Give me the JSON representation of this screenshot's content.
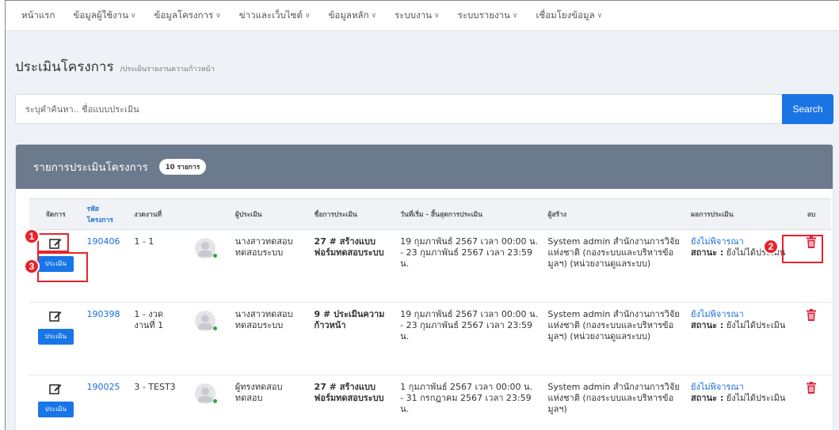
{
  "nav": {
    "items": [
      {
        "label": "หน้าแรก",
        "dropdown": false
      },
      {
        "label": "ข้อมูลผู้ใช้งาน",
        "dropdown": true
      },
      {
        "label": "ข้อมูลโครงการ",
        "dropdown": true
      },
      {
        "label": "ข่าวและเว็บไซต์",
        "dropdown": true
      },
      {
        "label": "ข้อมูลหลัก",
        "dropdown": true
      },
      {
        "label": "ระบบงาน",
        "dropdown": true
      },
      {
        "label": "ระบบรายงาน",
        "dropdown": true
      },
      {
        "label": "เชื่อมโยงข้อมูล",
        "dropdown": true
      }
    ]
  },
  "page": {
    "title": "ประเมินโครงการ",
    "breadcrumb": "/ประเมินรายงานความก้าวหน้า"
  },
  "search": {
    "placeholder": "ระบุคำค้นหา.. ชื่อแบบประเมิน",
    "button_label": "Search"
  },
  "panel": {
    "title": "รายการประเมินโครงการ",
    "count_badge": "10 รายการ"
  },
  "table": {
    "headers": {
      "manage": "จัดการ",
      "code": "รหัสโครงการ",
      "period": "งวดงานที่",
      "avatar": "",
      "assessor": "ผู้ประเมิน",
      "name": "ชื่อการประเมิน",
      "date": "วันที่เริ่ม - สิ้นสุดการประเมิน",
      "creator": "ผู้สร้าง",
      "result": "ผลการประเมิน",
      "delete": "ลบ"
    },
    "assess_button_label": "ประเมิน",
    "rows": [
      {
        "code": "190406",
        "period": "1 - 1",
        "assessor": "นางสาวทดสอบ ทดสอบระบบ",
        "name": "27 # สร้างแบบฟอร์มทดสอบระบบ",
        "date": "19 กุมภาพันธ์ 2567 เวลา 00:00 น. - 23 กุมภาพันธ์ 2567 เวลา 23:59 น.",
        "creator": "System admin สำนักงานการวิจัยแห่งชาติ (กองระบบและบริหารข้อมูลฯ) (หน่วยงานดูแลระบบ)",
        "result_link": "ยังไม่พิจารณา",
        "status_label": "สถานะ :",
        "status_value": "ยังไม่ได้ประเมิน"
      },
      {
        "code": "190398",
        "period": "1 - งวดงานที่ 1",
        "assessor": "นางสาวทดสอบ ทดสอบระบบ",
        "name": "9 # ประเมินความก้าวหน้า",
        "date": "19 กุมภาพันธ์ 2567 เวลา 00:00 น. - 23 กุมภาพันธ์ 2567 เวลา 23:59 น.",
        "creator": "System admin สำนักงานการวิจัยแห่งชาติ (กองระบบและบริหารข้อมูลฯ) (หน่วยงานดูแลระบบ)",
        "result_link": "ยังไม่พิจารณา",
        "status_label": "สถานะ :",
        "status_value": "ยังไม่ได้ประเมิน"
      },
      {
        "code": "190025",
        "period": "3 - TEST3",
        "assessor": "ผู้ทรงทดสอบ ทดสอบ",
        "name": "27 # สร้างแบบฟอร์มทดสอบระบบ",
        "date": "1 กุมภาพันธ์ 2567 เวลา 00:00 น. - 31 กรกฎาคม 2567 เวลา 23:59 น.",
        "creator": "System admin สำนักงานการวิจัยแห่งชาติ (กองระบบและบริหารข้อมูลฯ)",
        "result_link": "ยังไม่พิจารณา",
        "status_label": "สถานะ :",
        "status_value": "ยังไม่ได้ประเมิน"
      }
    ]
  },
  "callouts": [
    "1",
    "2",
    "3"
  ],
  "colors": {
    "primary": "#1b74e4",
    "panel_header": "#6c7a8e",
    "danger": "#d9233d",
    "callout": "#e8232a",
    "link": "#1a6fd6"
  }
}
